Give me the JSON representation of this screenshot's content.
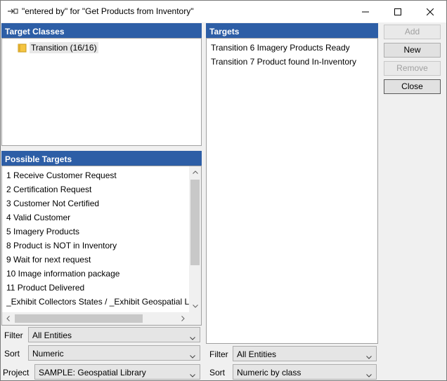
{
  "window": {
    "title": "\"entered by\" for \"Get Products from Inventory\""
  },
  "target_classes": {
    "header": "Target Classes",
    "items": [
      {
        "label": "Transition  (16/16)"
      }
    ]
  },
  "possible_targets": {
    "header": "Possible Targets",
    "items": [
      "1 Receive Customer Request",
      "2 Certification Request",
      "3 Customer Not Certified",
      "4 Valid Customer",
      "5 Imagery Products",
      "8 Product is NOT in Inventory",
      "9 Wait for next request",
      "10 Image information package",
      "11 Product Delivered",
      "_Exhibit Collectors States / _Exhibit Geospatial Lil"
    ],
    "vertical_scroll_fraction": 0.0
  },
  "targets": {
    "header": "Targets",
    "items": [
      "Transition 6 Imagery Products Ready",
      "Transition 7 Product found In-Inventory"
    ]
  },
  "buttons": {
    "add": "Add",
    "new": "New",
    "remove": "Remove",
    "close": "Close"
  },
  "left_controls": {
    "filter_label": "Filter",
    "filter_value": "All Entities",
    "sort_label": "Sort",
    "sort_value": "Numeric",
    "project_label": "Project",
    "project_value": "SAMPLE: Geospatial Library"
  },
  "right_controls": {
    "filter_label": "Filter",
    "filter_value": "All Entities",
    "sort_label": "Sort",
    "sort_value": "Numeric by class"
  },
  "colors": {
    "header_bg": "#2d5ea6",
    "folder": "#f5c542"
  },
  "icons": {
    "title": "link-arrow-icon",
    "minimize": "minimize-icon",
    "maximize": "maximize-icon",
    "close": "close-icon",
    "folder": "folder-icon"
  }
}
